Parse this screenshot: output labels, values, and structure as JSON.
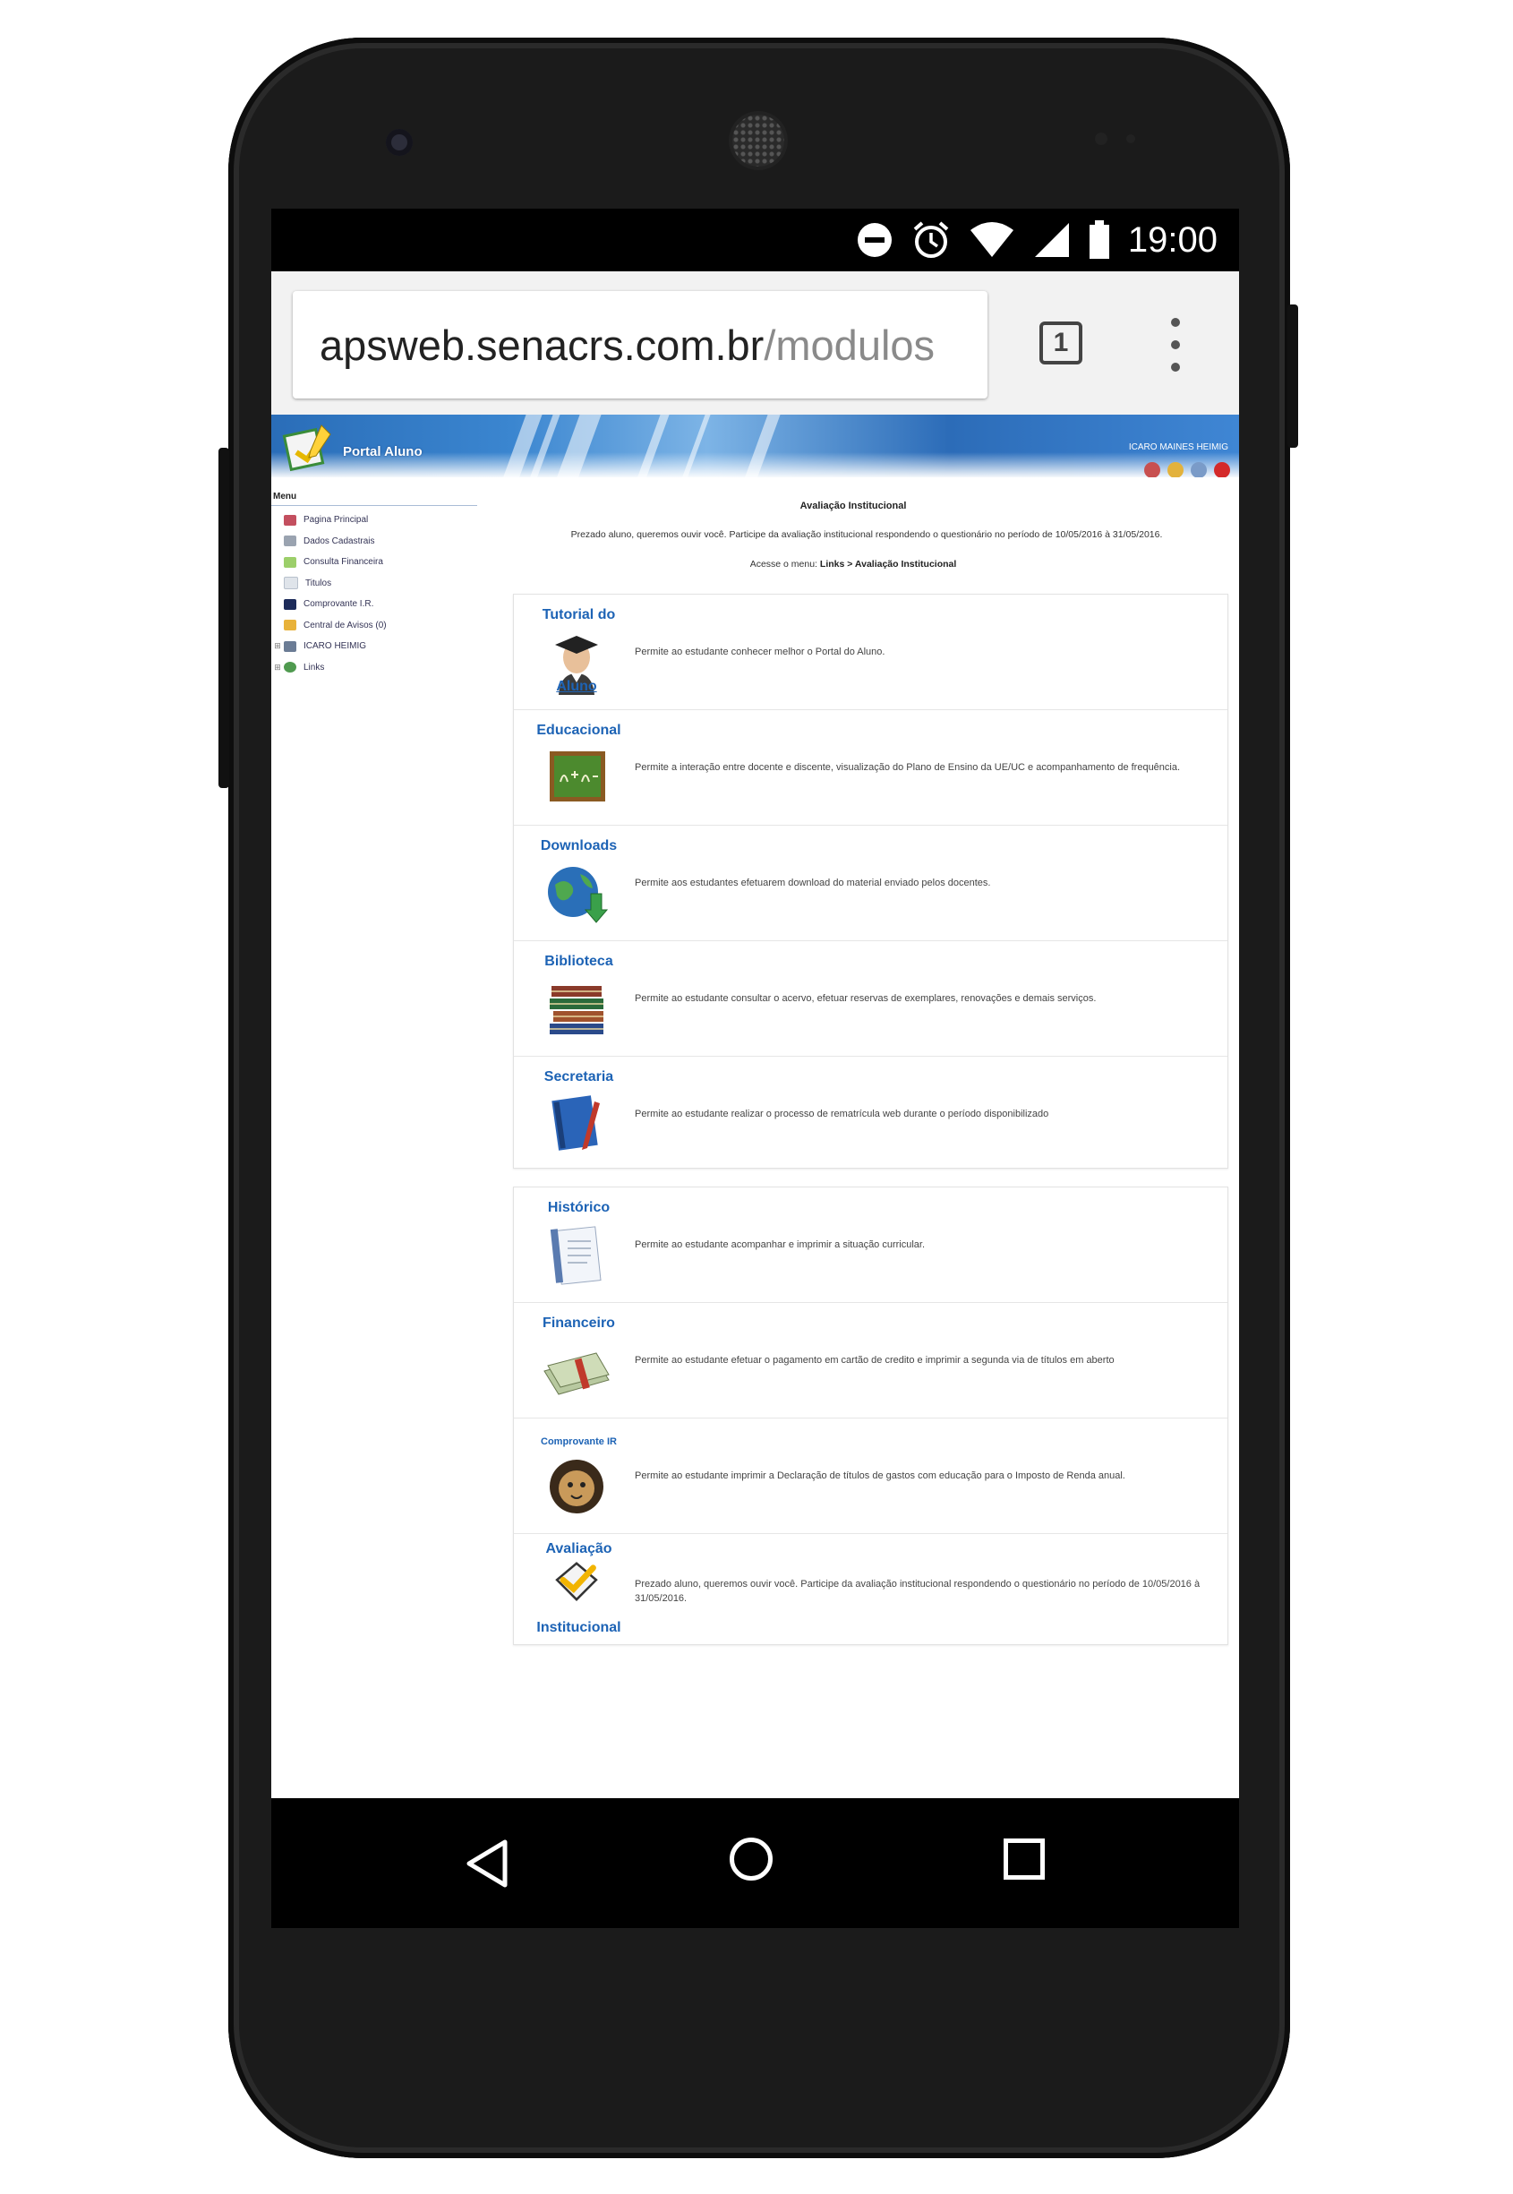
{
  "status_bar": {
    "time": "19:00",
    "icons": [
      "do-not-disturb-icon",
      "alarm-icon",
      "wifi-icon",
      "signal-icon",
      "battery-icon"
    ]
  },
  "browser": {
    "url_host": "apsweb.senacrs.com.br",
    "url_path": "/modulos",
    "tab_count": "1"
  },
  "header": {
    "portal_title": "Portal Aluno",
    "user_name": "ICARO MAINES HEIMIG"
  },
  "menu": {
    "title": "Menu",
    "items": [
      {
        "label": "Pagina Principal",
        "icon": "home-icon",
        "expand": ""
      },
      {
        "label": "Dados Cadastrais",
        "icon": "id-card-icon",
        "expand": ""
      },
      {
        "label": "Consulta Financeira",
        "icon": "money-icon",
        "expand": ""
      },
      {
        "label": "Titulos",
        "icon": "document-icon",
        "expand": ""
      },
      {
        "label": "Comprovante I.R.",
        "icon": "lion-icon",
        "expand": ""
      },
      {
        "label": "Central de Avisos (0)",
        "icon": "flag-icon",
        "expand": ""
      },
      {
        "label": "ICARO HEIMIG",
        "icon": "user-icon",
        "expand": "⊞"
      },
      {
        "label": "Links",
        "icon": "globe-icon",
        "expand": "⊞"
      }
    ]
  },
  "main": {
    "title": "Avaliação Institucional",
    "message": "Prezado aluno, queremos ouvir você. Participe da avaliação institucional respondendo o questionário no período de 10/05/2016 à 31/05/2016.",
    "nav_prefix": "Acesse o menu: ",
    "nav_path": "Links > Avaliação Institucional"
  },
  "modules_1": [
    {
      "title": "Tutorial do",
      "subtitle": "Aluno",
      "icon": "graduate-icon",
      "description": "Permite ao estudante conhecer melhor o Portal do Aluno."
    },
    {
      "title": "Educacional",
      "subtitle": "",
      "icon": "chalkboard-icon",
      "description": "Permite a interação entre docente e discente, visualização do Plano de Ensino da UE/UC e acompanhamento de frequência."
    },
    {
      "title": "Downloads",
      "subtitle": "",
      "icon": "globe-download-icon",
      "description": "Permite aos estudantes efetuarem download do material enviado pelos docentes."
    },
    {
      "title": "Biblioteca",
      "subtitle": "",
      "icon": "books-icon",
      "description": "Permite ao estudante consultar o acervo, efetuar reservas de exemplares, renovações e demais serviços."
    },
    {
      "title": "Secretaria",
      "subtitle": "",
      "icon": "notebook-icon",
      "description": "Permite ao estudante realizar o processo de rematrícula web durante o período disponibilizado"
    }
  ],
  "modules_2": [
    {
      "title": "Histórico",
      "subtitle": "",
      "icon": "document-icon",
      "description": "Permite ao estudante acompanhar e imprimir a situação curricular."
    },
    {
      "title": "Financeiro",
      "subtitle": "",
      "icon": "money-stack-icon",
      "description": "Permite ao estudante efetuar o pagamento em cartão de credito e imprimir a segunda via de títulos em aberto"
    },
    {
      "title": "Comprovante IR",
      "subtitle": "",
      "icon": "lion-icon",
      "description": "Permite ao estudante imprimir a Declaração de títulos de gastos com educação para o Imposto de Renda anual."
    },
    {
      "title": "Avaliação",
      "subtitle": "Institucional",
      "icon": "checkmark-icon",
      "description": "Prezado aluno, queremos ouvir você. Participe da avaliação institucional respondendo o questionário no período de 10/05/2016 à 31/05/2016."
    }
  ],
  "colors": {
    "banner_blue": "#2a6db8",
    "link_blue": "#1d63b5",
    "phone_body": "#1b1b1b"
  }
}
